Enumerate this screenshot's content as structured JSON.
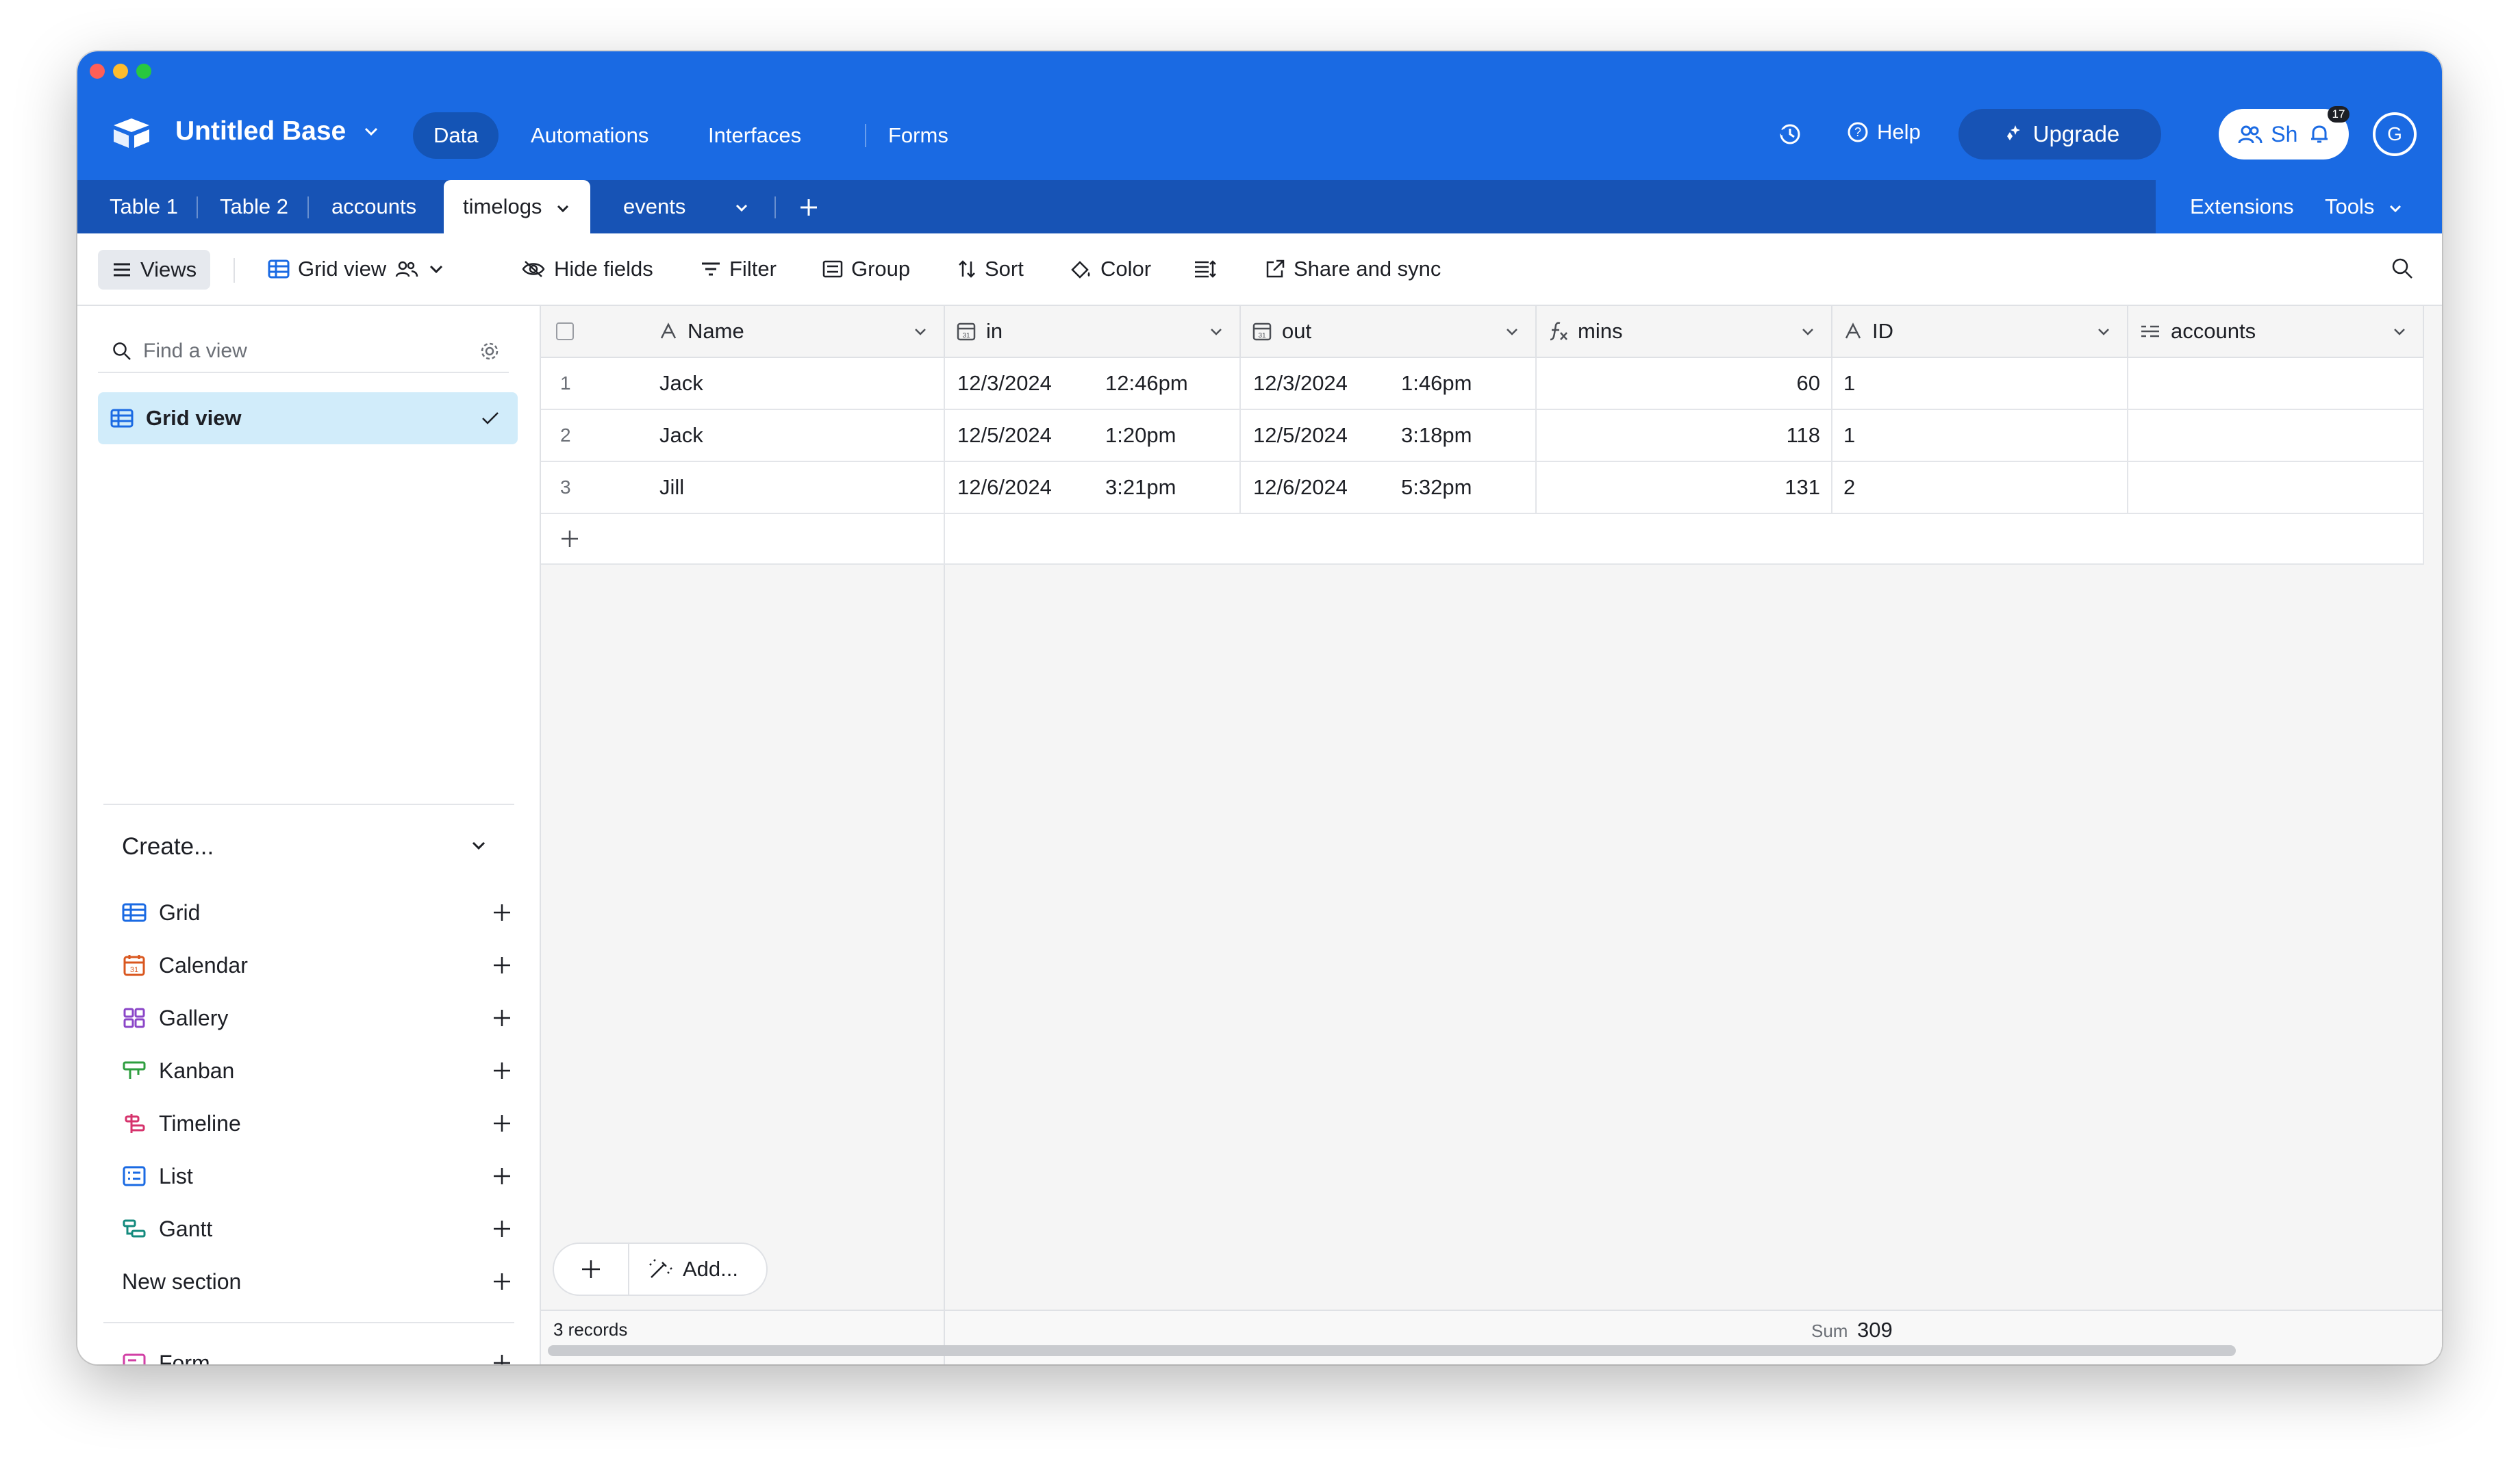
{
  "app": {
    "base_title": "Untitled Base",
    "nav_tabs": [
      {
        "label": "Data",
        "active": true
      },
      {
        "label": "Automations",
        "active": false
      },
      {
        "label": "Interfaces",
        "active": false
      },
      {
        "label": "Forms",
        "active": false
      }
    ],
    "help_label": "Help",
    "upgrade_label": "Upgrade",
    "share_label": "Share",
    "notification_count": "17",
    "avatar_initial": "G",
    "colors": {
      "primary": "#1a6ae3",
      "primary_dark": "#1753b5",
      "selected_view": "#d1ecfa"
    }
  },
  "tables": {
    "tabs": [
      {
        "label": "Table 1"
      },
      {
        "label": "Table 2"
      },
      {
        "label": "accounts"
      },
      {
        "label": "timelogs",
        "active": true
      },
      {
        "label": "events"
      }
    ],
    "extensions_label": "Extensions",
    "tools_label": "Tools"
  },
  "toolbar": {
    "views_label": "Views",
    "view_name": "Grid view",
    "hide_fields": "Hide fields",
    "filter": "Filter",
    "group": "Group",
    "sort": "Sort",
    "color": "Color",
    "share_sync": "Share and sync"
  },
  "sidebar": {
    "find_placeholder": "Find a view",
    "active_view": "Grid view",
    "create_title": "Create...",
    "create_items": [
      {
        "label": "Grid",
        "icon": "grid-icon"
      },
      {
        "label": "Calendar",
        "icon": "calendar-icon"
      },
      {
        "label": "Gallery",
        "icon": "gallery-icon"
      },
      {
        "label": "Kanban",
        "icon": "kanban-icon"
      },
      {
        "label": "Timeline",
        "icon": "timeline-icon"
      },
      {
        "label": "List",
        "icon": "list-icon"
      },
      {
        "label": "Gantt",
        "icon": "gantt-icon"
      }
    ],
    "new_section": "New section",
    "form": "Form"
  },
  "grid": {
    "columns": [
      {
        "label": "Name",
        "icon": "text-field-icon"
      },
      {
        "label": "in",
        "icon": "date-field-icon"
      },
      {
        "label": "out",
        "icon": "date-field-icon"
      },
      {
        "label": "mins",
        "icon": "formula-field-icon"
      },
      {
        "label": "ID",
        "icon": "text-field-icon"
      },
      {
        "label": "accounts",
        "icon": "link-field-icon"
      }
    ],
    "rows": [
      {
        "num": "1",
        "name": "Jack",
        "in_date": "12/3/2024",
        "in_time": "12:46pm",
        "out_date": "12/3/2024",
        "out_time": "1:46pm",
        "mins": "60",
        "id": "1",
        "accounts": ""
      },
      {
        "num": "2",
        "name": "Jack",
        "in_date": "12/5/2024",
        "in_time": "1:20pm",
        "out_date": "12/5/2024",
        "out_time": "3:18pm",
        "mins": "118",
        "id": "1",
        "accounts": ""
      },
      {
        "num": "3",
        "name": "Jill",
        "in_date": "12/6/2024",
        "in_time": "3:21pm",
        "out_date": "12/6/2024",
        "out_time": "5:32pm",
        "mins": "131",
        "id": "2",
        "accounts": ""
      }
    ],
    "add_label": "Add...",
    "records_count": "3 records",
    "sum_label": "Sum",
    "sum_value": "309"
  }
}
